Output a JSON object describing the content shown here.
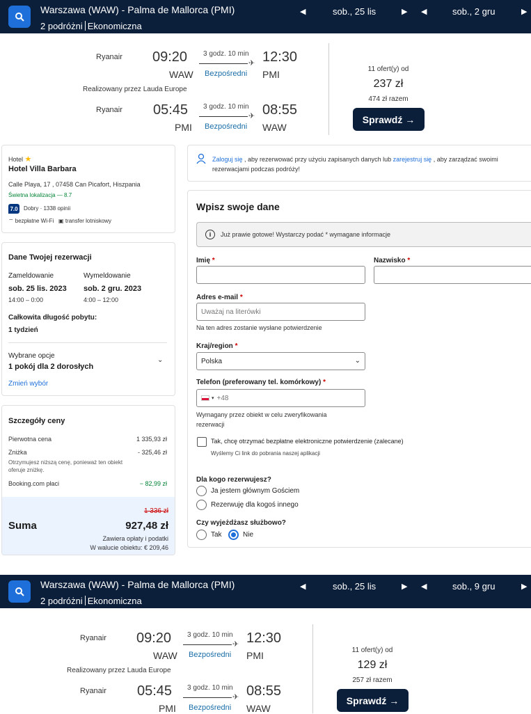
{
  "search1": {
    "route": "Warszawa (WAW) - Palma de Mallorca (PMI)",
    "travelers": "2 podróżni",
    "cabin": "Ekonomiczna",
    "depart_date": "sob., 25 lis",
    "return_date": "sob., 2 gru"
  },
  "flight1": {
    "outbound": {
      "airline": "Ryanair",
      "dep_time": "09:20",
      "dep_code": "WAW",
      "duration": "3 godz. 10 min",
      "stops": "Bezpośredni",
      "arr_time": "12:30",
      "arr_code": "PMI"
    },
    "operated_by": "Realizowany przez Lauda Europe",
    "inbound": {
      "airline": "Ryanair",
      "dep_time": "05:45",
      "dep_code": "PMI",
      "duration": "3 godz. 10 min",
      "stops": "Bezpośredni",
      "arr_time": "08:55",
      "arr_code": "WAW"
    },
    "offers": "11 ofert(y) od",
    "price": "237 zł",
    "total": "474 zł razem",
    "cta": "Sprawdź →"
  },
  "hotel": {
    "type_label": "Hotel",
    "name": "Hotel Villa Barbara",
    "address": "Calle Playa, 17 , 07458 Can Picafort, Hiszpania",
    "location_score": "Świetna lokalizacja — 8.7",
    "rating": "7.0",
    "rating_text": "Dobry · 1338 opinii",
    "amenity_wifi": "bezpłatne Wi-Fi",
    "amenity_transfer": "transfer lotniskowy"
  },
  "booking": {
    "title": "Dane Twojej rezerwacji",
    "checkin_label": "Zameldowanie",
    "checkin_date": "sob. 25 lis. 2023",
    "checkin_time": "14:00 – 0:00",
    "checkout_label": "Wymeldowanie",
    "checkout_date": "sob. 2 gru. 2023",
    "checkout_time": "4:00 – 12:00",
    "length_label": "Całkowita długość pobytu:",
    "length_value": "1 tydzień",
    "options_label": "Wybrane opcje",
    "options_value": "1 pokój dla 2 dorosłych",
    "change_link": "Zmień wybór"
  },
  "price_details": {
    "title": "Szczegóły ceny",
    "original_label": "Pierwotna cena",
    "original_value": "1 335,93 zł",
    "discount_label": "Zniżka",
    "discount_value": "- 325,46 zł",
    "discount_note": "Otrzymujesz niższą cenę, ponieważ ten obiekt oferuje zniżkę.",
    "booking_label": "Booking.com płaci",
    "booking_value": "− 82,99 zł",
    "old_total": "1 336 zł",
    "sum_label": "Suma",
    "sum_value": "927,48 zł",
    "fees_note": "Zawiera opłaty i podatki",
    "local_currency": "W walucie obiektu: € 209,46"
  },
  "signin": {
    "link_login": "Zaloguj się",
    "text_mid": ", aby rezerwować przy użyciu zapisanych danych lub",
    "link_register": "zarejestruj się",
    "text_end": ", aby zarządzać swoimi rezerwacjami podczas podróży!"
  },
  "form": {
    "title": "Wpisz swoje dane",
    "notice": "Już prawie gotowe! Wystarczy podać * wymagane informacje",
    "first_name_label": "Imię",
    "last_name_label": "Nazwisko",
    "email_label": "Adres e-mail",
    "email_placeholder": "Uważaj na literówki",
    "email_hint": "Na ten adres zostanie wysłane potwierdzenie",
    "country_label": "Kraj/region",
    "country_value": "Polska",
    "phone_label": "Telefon (preferowany tel. komórkowy)",
    "phone_prefix": "+48",
    "phone_hint": "Wymagany przez obiekt w celu zweryfikowania rezerwacji",
    "confirm_checkbox": "Tak, chcę otrzymać bezpłatne elektroniczne potwierdzenie (zalecane)",
    "confirm_note": "Wyślemy Ci link do pobrania naszej aplikacji",
    "who_label": "Dla kogo rezerwujesz?",
    "who_me": "Ja jestem głównym Gościem",
    "who_other": "Rezerwuję dla kogoś innego",
    "business_label": "Czy wyjeżdżasz służbowo?",
    "business_yes": "Tak",
    "business_no": "Nie",
    "required_star": "*"
  },
  "search2": {
    "route": "Warszawa (WAW) - Palma de Mallorca (PMI)",
    "travelers": "2 podróżni",
    "cabin": "Ekonomiczna",
    "depart_date": "sob., 25 lis",
    "return_date": "sob., 9 gru"
  },
  "flight2": {
    "outbound": {
      "airline": "Ryanair",
      "dep_time": "09:20",
      "dep_code": "WAW",
      "duration": "3 godz. 10 min",
      "stops": "Bezpośredni",
      "arr_time": "12:30",
      "arr_code": "PMI"
    },
    "operated_by": "Realizowany przez Lauda Europe",
    "inbound": {
      "airline": "Ryanair",
      "dep_time": "05:45",
      "dep_code": "PMI",
      "duration": "3 godz. 10 min",
      "stops": "Bezpośredni",
      "arr_time": "08:55",
      "arr_code": "WAW"
    },
    "offers": "11 ofert(y) od",
    "price": "129 zł",
    "total": "257 zł razem",
    "cta": "Sprawdź →"
  },
  "colors": {
    "navy": "#0b1e3a",
    "accent_blue": "#1e6fd9",
    "rating_blue": "#003580",
    "green": "#008234",
    "red": "#cc0000",
    "sum_bg": "#ebf3ff"
  },
  "icons": [
    "search-icon",
    "chevron-left-icon",
    "chevron-right-icon",
    "star-icon",
    "wifi-icon",
    "shuttle-icon",
    "user-icon",
    "info-icon",
    "chevron-down-icon",
    "plane-icon",
    "flag-icon"
  ]
}
